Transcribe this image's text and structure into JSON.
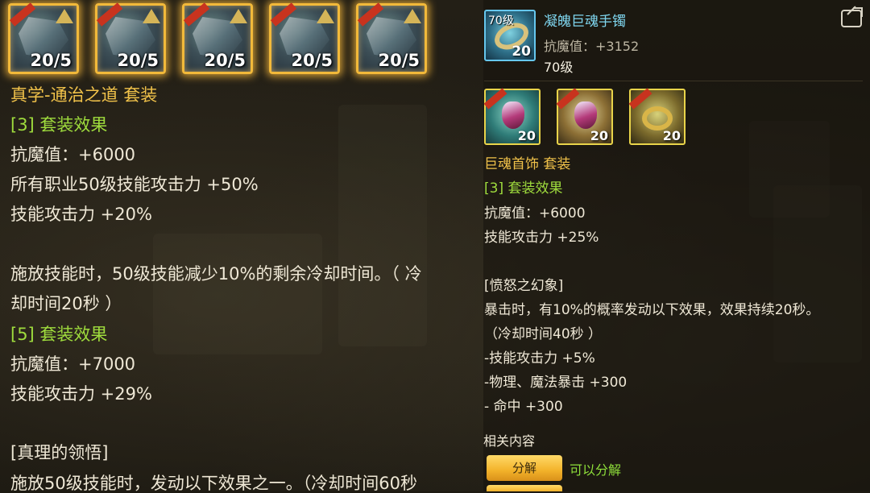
{
  "left_panel": {
    "set_items": [
      {
        "level": "20/5"
      },
      {
        "level": "20/5"
      },
      {
        "level": "20/5"
      },
      {
        "level": "20/5"
      },
      {
        "level": "20/5"
      }
    ],
    "set_name": "真学-通治之道 套装",
    "effect3_header": "[3] 套装效果",
    "effect3_lines": [
      "抗魔值：+6000",
      "所有职业50级技能攻击力 +50%",
      "技能攻击力 +20%"
    ],
    "effect3_desc_1": "施放技能时，50级技能减少10%的剩余冷却时间。（ 冷",
    "effect3_desc_2": "却时间20秒 ）",
    "effect5_header": "[5] 套装效果",
    "effect5_lines": [
      "抗魔值：+7000",
      "技能攻击力 +29%"
    ],
    "truth_header": "[真理的领悟]",
    "truth_desc_partial": "施放50级技能时，发动以下效果之一。（冷却时间60秒"
  },
  "right_panel": {
    "item": {
      "icon_level_tag": "70级",
      "icon_number": "20",
      "name": "凝魄巨魂手镯",
      "stat": "抗魔值：+3152",
      "level": "70级"
    },
    "accessories": [
      {
        "number": "20"
      },
      {
        "number": "20"
      },
      {
        "number": "20"
      }
    ],
    "set_name": "巨魂首饰 套装",
    "effect3_header": "[3] 套装效果",
    "effect3_lines": [
      "抗魔值：+6000",
      "技能攻击力 +25%"
    ],
    "rage_header": "[愤怒之幻象]",
    "rage_lines": [
      "暴击时，有10%的概率发动以下效果，效果持续20秒。",
      "（冷却时间40秒 ）",
      "-技能攻击力 +5%",
      "-物理、魔法暴击 +300",
      "- 命中 +300"
    ],
    "related_label": "相关内容",
    "decompose_button": "分解",
    "decompose_status": "可以分解"
  },
  "colors": {
    "gold": "#f1c24a",
    "green": "#9fdc3d",
    "cyan_title": "#7fd6ef",
    "button": "#f3b22a"
  }
}
